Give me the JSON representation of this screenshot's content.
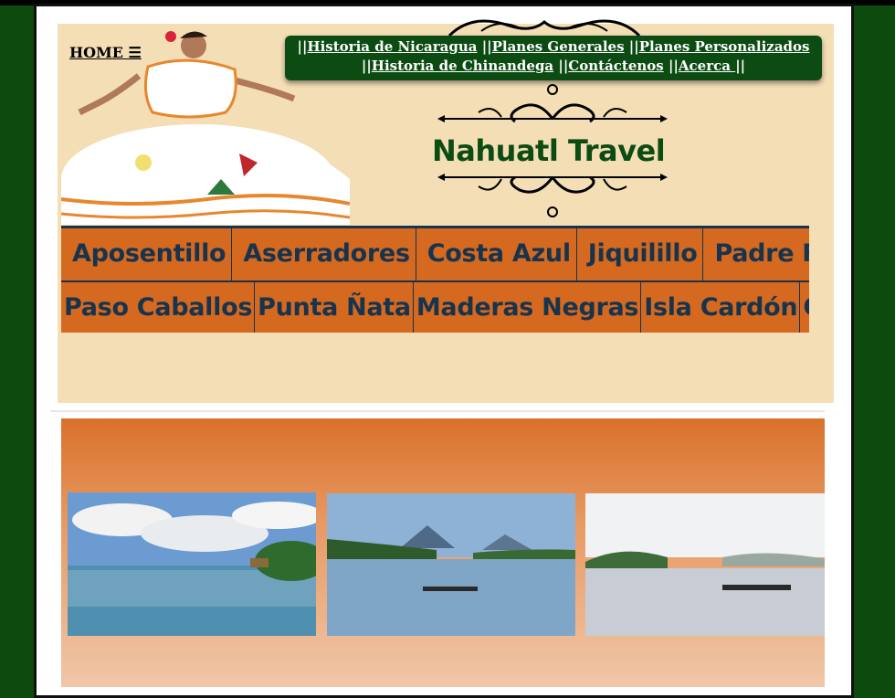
{
  "home": {
    "label": "HOME ☰"
  },
  "topnav": {
    "line1": [
      "Historia de Nicaragua",
      "Planes Generales",
      "Planes Personalizados"
    ],
    "line2": [
      "Historia de Chinandega",
      "Contáctenos",
      "Acerca "
    ]
  },
  "brand": {
    "name": "Nahuatl Travel"
  },
  "beaches": {
    "row1": [
      "Aposentillo",
      "Aserradores",
      "Costa Azul",
      "Jiquilillo",
      "Padre Ramos"
    ],
    "row2": [
      "Paso Caballos",
      "Punta Ñata",
      "Maderas Negras",
      "Isla Cardón",
      "Costa Grande"
    ]
  },
  "colors": {
    "page_bg": "#0d4a0d",
    "header_bg": "#f4deb6",
    "nav_bg": "#0c4c13",
    "beach_bg": "#d4691f",
    "beach_text": "#17344f"
  },
  "icons": [
    "hamburger-icon",
    "scroll-ornament-icon"
  ]
}
